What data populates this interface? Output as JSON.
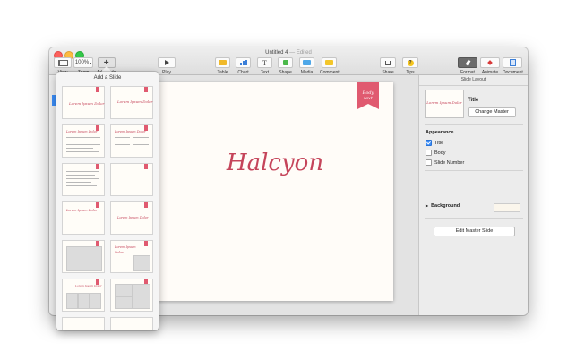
{
  "window": {
    "title": "Untitled 4",
    "title_separator": "—",
    "status": "Edited"
  },
  "toolbar": {
    "view": {
      "label": "View",
      "icon": "sidebar-view-icon"
    },
    "zoom": {
      "label": "Zoom",
      "value": "100%"
    },
    "add_slide": {
      "label": "Add Slide",
      "icon": "plus-icon",
      "glyph": "+"
    },
    "play": {
      "label": "Play",
      "icon": "play-icon"
    },
    "insert": [
      {
        "label": "Table",
        "icon": "table-icon",
        "color": "#f0b92a"
      },
      {
        "label": "Chart",
        "icon": "chart-icon",
        "color": "#3b7fd8"
      },
      {
        "label": "Text",
        "icon": "text-icon",
        "glyph": "T"
      },
      {
        "label": "Shape",
        "icon": "shape-icon",
        "color": "#4bb84a"
      },
      {
        "label": "Media",
        "icon": "media-icon",
        "color": "#4ea7e8"
      },
      {
        "label": "Comment",
        "icon": "comment-icon",
        "color": "#f3c62a"
      }
    ],
    "share": {
      "label": "Share",
      "icon": "share-icon"
    },
    "tips": {
      "label": "Tips",
      "icon": "tips-icon",
      "glyph": "?"
    },
    "format": {
      "label": "Format",
      "icon": "paintbrush-icon"
    },
    "animate": {
      "label": "Animate",
      "icon": "diamond-icon",
      "color": "#d83a3a"
    },
    "document": {
      "label": "Document",
      "icon": "document-icon",
      "color": "#3b7fd8"
    }
  },
  "add_slide_popover": {
    "title": "Add a Slide",
    "sample_title": "Lorem Ipsum Dolor",
    "sample_short": "Lorem Ipsum",
    "sample_word": "Dolor"
  },
  "slide": {
    "title": "Halcyon",
    "ribbon_line1": "Body",
    "ribbon_line2": "text",
    "accent": "#c5445a"
  },
  "inspector": {
    "header": "Slide Layout",
    "master_thumb_text": "Lorem Ipsum Dolor",
    "master_name": "Title",
    "change_master": "Change Master",
    "appearance_label": "Appearance",
    "options": [
      {
        "label": "Title",
        "checked": true
      },
      {
        "label": "Body",
        "checked": false
      },
      {
        "label": "Slide Number",
        "checked": false
      }
    ],
    "background_label": "Background",
    "background_color": "#fbf6ec",
    "edit_master": "Edit Master Slide"
  }
}
